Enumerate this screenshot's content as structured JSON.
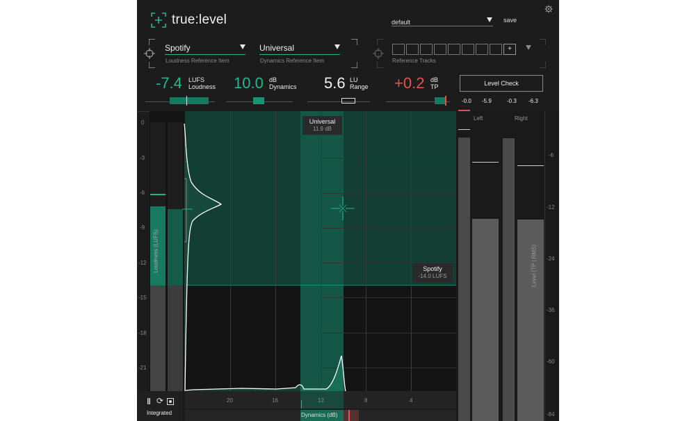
{
  "app": {
    "logo_text": "true:level"
  },
  "header": {
    "preset_value": "default",
    "save_label": "save"
  },
  "loudness_ref": {
    "value": "Spotify",
    "label": "Loudness Reference Item"
  },
  "dynamics_ref": {
    "value": "Universal",
    "label": "Dynamics Reference Item"
  },
  "ref_tracks": {
    "label": "Reference Tracks",
    "add_label": "+"
  },
  "readouts": {
    "loudness": {
      "value": "-7.4",
      "unit": "LUFS",
      "name": "Loudness"
    },
    "dynamics": {
      "value": "10.0",
      "unit": "dB",
      "name": "Dynamics"
    },
    "range": {
      "value": "5.6",
      "unit": "LU",
      "name": "Range"
    },
    "tp": {
      "value": "+0.2",
      "unit": "dB",
      "name": "TP"
    }
  },
  "level_check": {
    "label": "Level Check"
  },
  "meter_values": [
    "-0.0",
    "-5.9",
    "-0.3",
    "-6.3"
  ],
  "chart_data": {
    "type": "area",
    "y_ticks": [
      "0",
      "-3",
      "-6",
      "-9",
      "-12",
      "-15",
      "-18",
      "-21"
    ],
    "ylabel": "Loudness (LUFS)",
    "x_ticks": [
      "20",
      "16",
      "12",
      "8",
      "4"
    ],
    "xlabel": "Dynamics (dB)",
    "universal_tip": {
      "title": "Universal",
      "value": "11.9 dB"
    },
    "spotify_tip": {
      "title": "Spotify",
      "value": "-14.0 LUFS"
    }
  },
  "level_meter": {
    "left_label": "Left",
    "right_label": "Right",
    "scale": [
      "-6",
      "-12",
      "-24",
      "-36",
      "-60",
      "-84"
    ],
    "axis_label": "Level (TP | RMS)"
  },
  "transport": {
    "mode_label": "Integrated"
  },
  "colors": {
    "accent": "#1fb890",
    "alert": "#e85050",
    "background": "#1c1c1c"
  }
}
